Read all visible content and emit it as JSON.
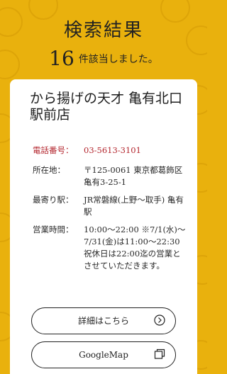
{
  "header": {
    "title": "検索結果",
    "count": "16",
    "count_suffix": "件該当しました。"
  },
  "shop": {
    "name": "から揚げの天才 亀有北口駅前店",
    "tel_label": "電話番号：",
    "tel_value": "03-5613-3101",
    "address_label": "所在地：",
    "address_value": "〒125-0061 東京都葛飾区亀有3-25-1",
    "station_label": "最寄り駅：",
    "station_value": "JR常磐線(上野～取手) 亀有駅",
    "hours_label": "営業時間：",
    "hours_value": "10:00～22:00 ※7/1(水)～7/31(金)は11:00～22:30　祝休日は22:00迄の営業とさせていただきます。"
  },
  "buttons": {
    "detail_label": "詳細はこちら",
    "map_label": "GoogleMap"
  },
  "colors": {
    "accent": "#e9b10d",
    "tel": "#b3262e"
  },
  "icons": {
    "detail": "chevron-right-circle-icon",
    "map": "copy-window-icon"
  }
}
